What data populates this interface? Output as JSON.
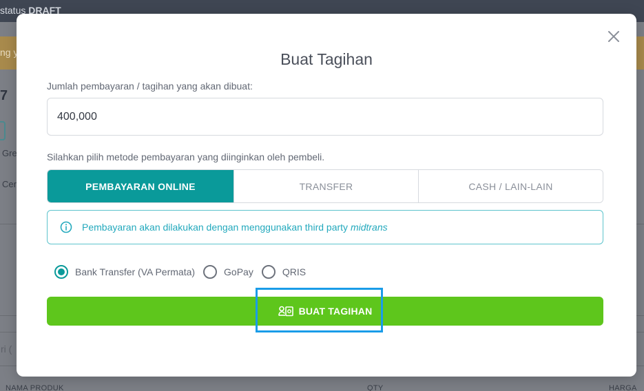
{
  "background": {
    "status_prefix": "status",
    "status_value": "DRAFT",
    "banner_text": "ng y",
    "number_fragment": "7",
    "label_1": "Gre",
    "label_2": "Cer",
    "search_placeholder_fragment": "ri (",
    "table_headers": [
      "NAMA PRODUK",
      "QTY",
      "HARGA"
    ]
  },
  "modal": {
    "title": "Buat Tagihan",
    "amount_label": "Jumlah pembayaran / tagihan yang akan dibuat:",
    "amount_value": "400,000",
    "method_label": "Silahkan pilih metode pembayaran yang diinginkan oleh pembeli.",
    "tabs": [
      {
        "label": "PEMBAYARAN ONLINE",
        "active": true
      },
      {
        "label": "TRANSFER",
        "active": false
      },
      {
        "label": "CASH / LAIN-LAIN",
        "active": false
      }
    ],
    "info": {
      "text": "Pembayaran akan dilakukan dengan menggunakan third party ",
      "provider": "midtrans",
      "icon": "info-icon"
    },
    "options": [
      {
        "label": "Bank Transfer (VA Permata)",
        "checked": true
      },
      {
        "label": "GoPay",
        "checked": false
      },
      {
        "label": "QRIS",
        "checked": false
      }
    ],
    "submit_label": "BUAT TAGIHAN",
    "submit_icon": "bill-user-icon",
    "close_icon": "close-icon"
  },
  "colors": {
    "accent": "#0a9a9a",
    "submit": "#5ec61c",
    "info": "#23a9bd",
    "highlight": "#1a9ce8"
  }
}
